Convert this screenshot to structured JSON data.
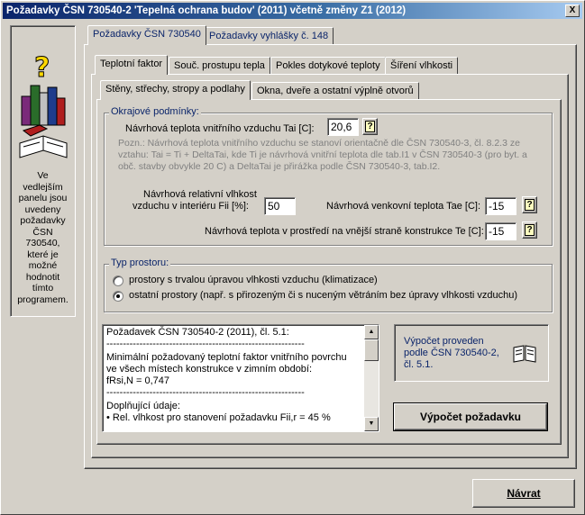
{
  "window": {
    "title": "Požadavky ČSN 730540-2 'Tepelná ochrana budov' (2011) včetně změny Z1 (2012)",
    "close_label": "X"
  },
  "sidebar": {
    "icon": "help-books-icon",
    "description": "Ve\nvedlejším\npanelu jsou\nuvedeny\npožadavky\nČSN\n730540,\nkteré je\nmožné\nhodnotit\ntímto\nprogramem."
  },
  "top_tabs": [
    {
      "label": "Požadavky ČSN 730540",
      "active": true
    },
    {
      "label": "Požadavky vyhlášky č. 148",
      "active": false
    }
  ],
  "sub_tabs": [
    {
      "label": "Teplotní faktor",
      "active": true
    },
    {
      "label": "Souč. prostupu tepla",
      "active": false
    },
    {
      "label": "Pokles dotykové teploty",
      "active": false
    },
    {
      "label": "Šíření vlhkosti",
      "active": false
    }
  ],
  "inner_tabs": [
    {
      "label": "Stěny, střechy, stropy a podlahy",
      "active": true
    },
    {
      "label": "Okna, dveře a ostatní výplně otvorů",
      "active": false
    }
  ],
  "boundary": {
    "title": "Okrajové podmínky:",
    "tai_label": "Návrhová teplota vnitřního vzduchu    Tai [C]:",
    "tai_value": "20,6",
    "note": "Pozn.: Návrhová teplota vnitřního vzduchu se stanoví orientačně dle ČSN 730540-3, čl. 8.2.3 ze vztahu: Tai = Ti + DeltaTai, kde Ti je návrhová vnitřní teplota dle tab.I1 v ČSN 730540-3 (pro byt. a obč. stavby obvykle 20 C) a DeltaTai je přirážka podle ČSN 730540-3, tab.I2.",
    "rh_label_line1": "Návrhová relativní vlhkost",
    "rh_label_line2": "vzduchu v interiéru  Fii [%]:",
    "rh_value": "50",
    "tae_label": "Návrhová venkovní teplota Tae [C]:",
    "tae_value": "-15",
    "te_label": "Návrhová teplota v prostředí na vnější straně konstrukce Te [C]:",
    "te_value": "-15",
    "help_label": "?"
  },
  "room_type": {
    "title": "Typ prostoru:",
    "options": [
      {
        "label": "prostory s trvalou úpravou vlhkosti vzduchu (klimatizace)",
        "checked": false
      },
      {
        "label": "ostatní prostory (např. s přirozeným či s nuceným větráním bez úpravy vlhkosti vzduchu)",
        "checked": true
      }
    ]
  },
  "result": {
    "lines": [
      "Požadavek ČSN 730540-2 (2011), čl. 5.1:",
      "------------------------------------------------------------",
      "Minimální požadovaný teplotní faktor vnitřního povrchu ve všech místech konstrukce v zimním období:",
      "fRsi,N = 0,747",
      "------------------------------------------------------------",
      "Doplňující údaje:",
      "• Rel. vlhkost pro stanovení požadavku Fii,r = 45 %"
    ],
    "scroll_up": "▲",
    "scroll_down": "▼"
  },
  "calc_info": {
    "text": "Výpočet proveden podle ČSN 730540-2, čl. 5.1.",
    "icon": "open-book-icon"
  },
  "buttons": {
    "calculate": "Výpočet požadavku",
    "back": "Návrat"
  }
}
